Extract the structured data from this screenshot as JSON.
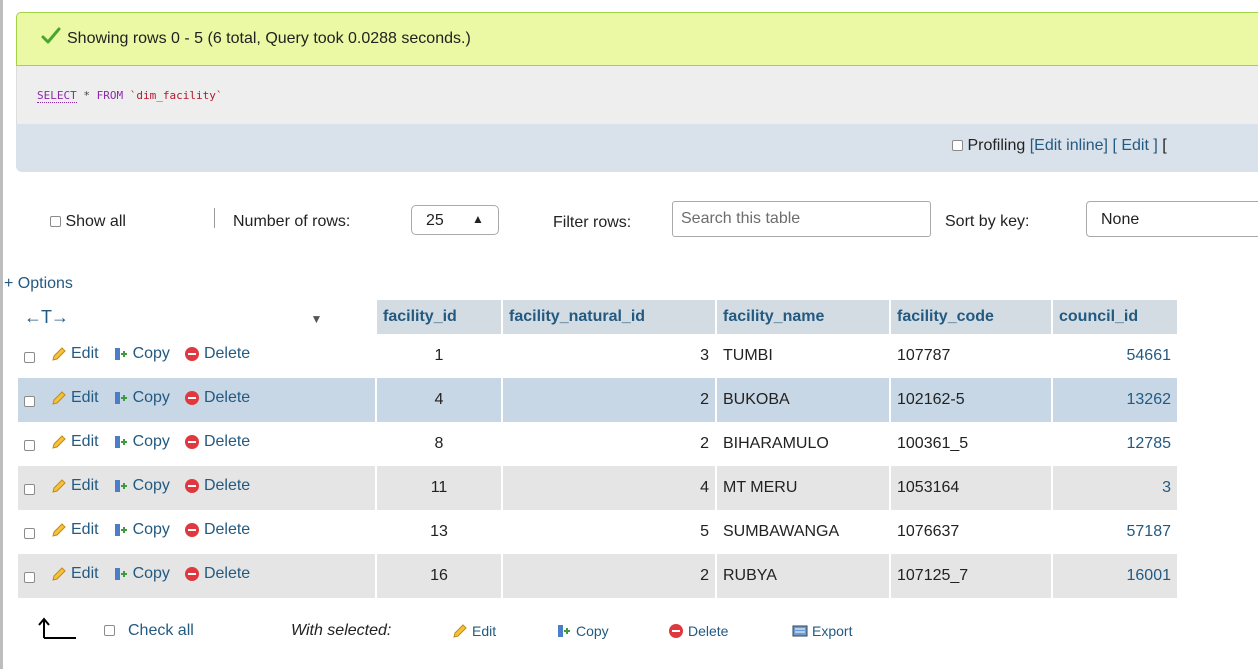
{
  "banner": {
    "message": "Showing rows 0 - 5 (6 total, Query took 0.0288 seconds.)"
  },
  "sql": {
    "select": "SELECT",
    "star": "*",
    "from": "FROM",
    "table": "`dim_facility`"
  },
  "profiling": {
    "label": "Profiling",
    "edit_inline": "[Edit inline]",
    "edit": "[ Edit ]",
    "trail": "["
  },
  "navigation": {
    "show_all": "Show all",
    "rows_label": "Number of rows:",
    "rows_value": "25",
    "filter_label": "Filter rows:",
    "filter_placeholder": "Search this table",
    "sort_label": "Sort by key:",
    "sort_value": "None"
  },
  "options_link": "+ Options",
  "table": {
    "arrows": "←T→",
    "columns": [
      "facility_id",
      "facility_natural_id",
      "facility_name",
      "facility_code",
      "council_id"
    ],
    "actions": {
      "edit": "Edit",
      "copy": "Copy",
      "delete": "Delete"
    },
    "rows": [
      {
        "facility_id": "1",
        "facility_natural_id": "3",
        "facility_name": "TUMBI",
        "facility_code": "107787",
        "council_id": "54661"
      },
      {
        "facility_id": "4",
        "facility_natural_id": "2",
        "facility_name": "BUKOBA",
        "facility_code": "102162-5",
        "council_id": "13262"
      },
      {
        "facility_id": "8",
        "facility_natural_id": "2",
        "facility_name": "BIHARAMULO",
        "facility_code": "100361_5",
        "council_id": "12785"
      },
      {
        "facility_id": "11",
        "facility_natural_id": "4",
        "facility_name": "MT MERU",
        "facility_code": "1053164",
        "council_id": "3"
      },
      {
        "facility_id": "13",
        "facility_natural_id": "5",
        "facility_name": "SUMBAWANGA",
        "facility_code": "1076637",
        "council_id": "57187"
      },
      {
        "facility_id": "16",
        "facility_natural_id": "2",
        "facility_name": "RUBYA",
        "facility_code": "107125_7",
        "council_id": "16001"
      }
    ]
  },
  "bottom": {
    "check_all": "Check all",
    "with_selected": "With selected:",
    "edit": "Edit",
    "copy": "Copy",
    "delete": "Delete",
    "export": "Export"
  },
  "colors": {
    "link": "#235a81",
    "banner_bg": "#ebf8a4",
    "header_bg": "#d3dce3",
    "selected_row": "#c8d7e6"
  }
}
